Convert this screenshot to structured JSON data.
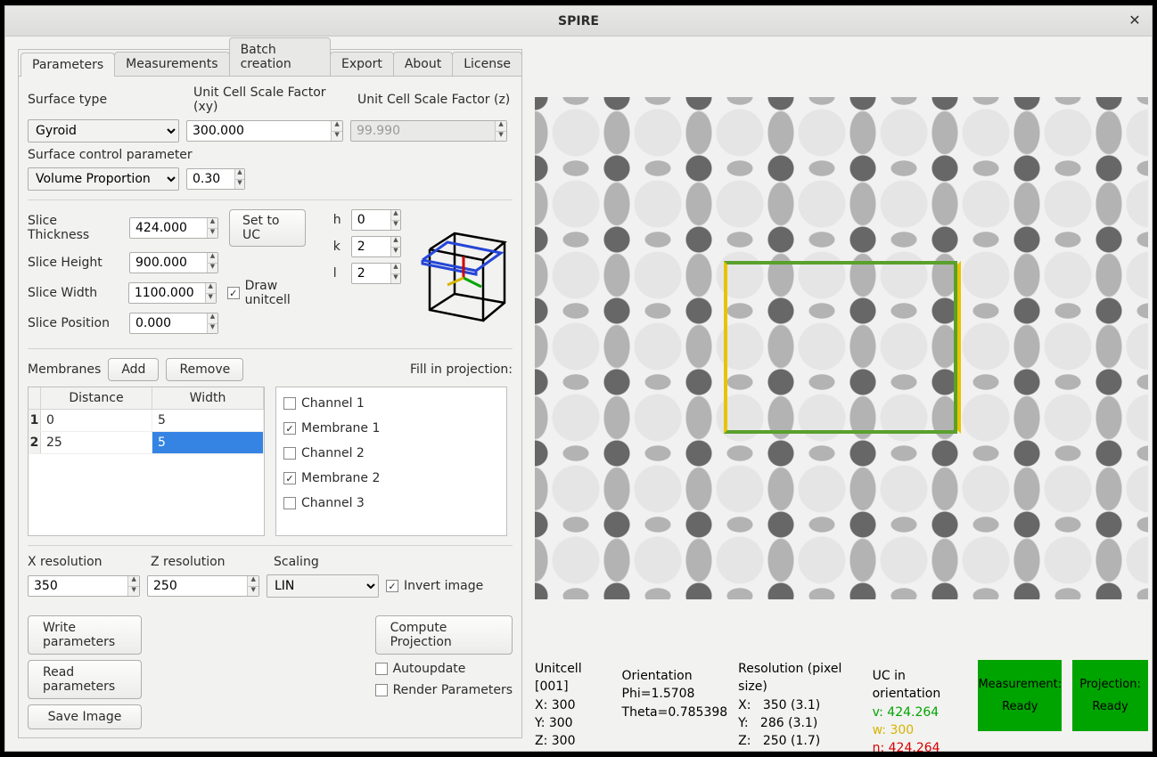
{
  "window": {
    "title": "SPIRE"
  },
  "tabs": [
    "Parameters",
    "Measurements",
    "Batch creation",
    "Export",
    "About",
    "License"
  ],
  "active_tab": "Parameters",
  "labels": {
    "surface_type": "Surface type",
    "ucsf_xy": "Unit Cell Scale Factor (xy)",
    "ucsf_z": "Unit Cell Scale Factor  (z)",
    "scp": "Surface control parameter",
    "slice_thickness": "Slice Thickness",
    "slice_height": "Slice Height",
    "slice_width": "Slice Width",
    "slice_position": "Slice Position",
    "set_to_uc": "Set to UC",
    "draw_uc": "Draw unitcell",
    "h": "h",
    "k": "k",
    "l": "l",
    "membranes": "Membranes",
    "add": "Add",
    "remove": "Remove",
    "fill_label": "Fill in projection:",
    "distance": "Distance",
    "width": "Width",
    "xres": "X resolution",
    "zres": "Z resolution",
    "scaling": "Scaling",
    "invert": "Invert image",
    "write_params": "Write parameters",
    "read_params": "Read parameters",
    "save_image": "Save Image",
    "compute": "Compute Projection",
    "autoupdate": "Autoupdate",
    "render_params": "Render Parameters"
  },
  "values": {
    "surface_type": "Gyroid",
    "ucsf_xy": "300.000",
    "ucsf_z": "99.990",
    "scp_mode": "Volume Proportion",
    "scp_value": "0.30",
    "slice_thickness": "424.000",
    "slice_height": "900.000",
    "slice_width": "1100.000",
    "slice_position": "0.000",
    "h": "0",
    "k": "2",
    "l": "2",
    "draw_uc": true,
    "xres": "350",
    "zres": "250",
    "scaling": "LIN",
    "invert": true,
    "autoupdate": false,
    "render_params": false
  },
  "membranes_table": {
    "rows": [
      {
        "n": "1",
        "distance": "0",
        "width": "5"
      },
      {
        "n": "2",
        "distance": "25",
        "width": "5",
        "width_selected": true
      }
    ]
  },
  "fill_options": [
    {
      "label": "Channel 1",
      "checked": false
    },
    {
      "label": "Membrane 1",
      "checked": true
    },
    {
      "label": "Channel 2",
      "checked": false
    },
    {
      "label": "Membrane 2",
      "checked": true
    },
    {
      "label": "Channel 3",
      "checked": false
    }
  ],
  "status": {
    "unitcell_title": "Unitcell [001]",
    "uc_x": "X: 300",
    "uc_y": "Y: 300",
    "uc_z": "Z: 300",
    "orient_title": "Orientation",
    "orient_phi": "Phi=1.5708",
    "orient_theta": "Theta=0.785398",
    "res_title": "Resolution (pixel size)",
    "res_x": "X:   350 (3.1)",
    "res_y": "Y:   286 (3.1)",
    "res_z": "Z:   250 (1.7)",
    "uc_orient_title": "UC in orientation",
    "uc_v": "v: 424.264",
    "uc_w": "w: 300",
    "uc_n": "n: 424.264",
    "meas_badge_a": "Measurement:",
    "meas_badge_b": "Ready",
    "proj_badge_a": "Projection:",
    "proj_badge_b": "Ready"
  },
  "colors": {
    "green": "#5aa02c",
    "yellow": "#e7c400"
  }
}
